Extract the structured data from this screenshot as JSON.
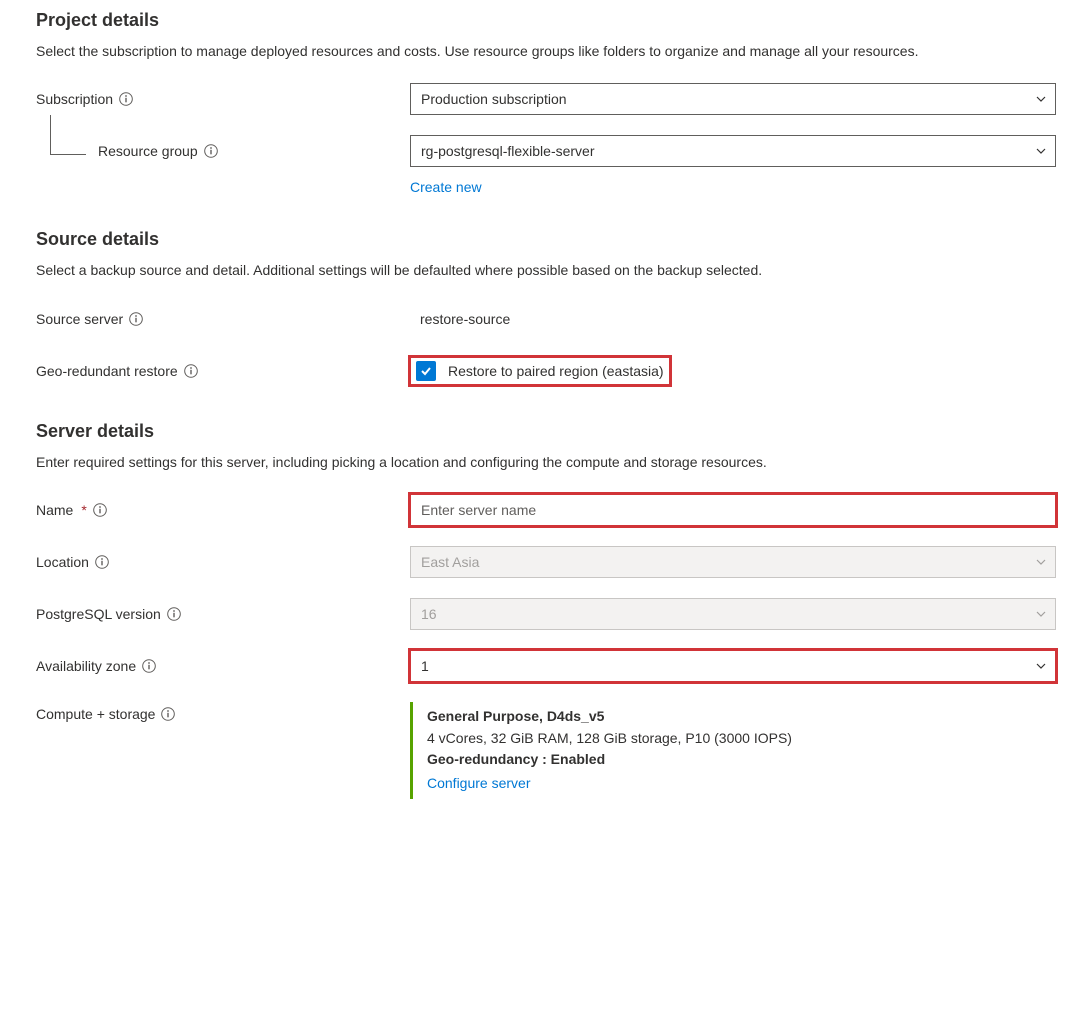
{
  "project_details": {
    "heading": "Project details",
    "description": "Select the subscription to manage deployed resources and costs. Use resource groups like folders to organize and manage all your resources.",
    "subscription": {
      "label": "Subscription",
      "value": "Production subscription"
    },
    "resource_group": {
      "label": "Resource group",
      "value": "rg-postgresql-flexible-server",
      "create_new": "Create new"
    }
  },
  "source_details": {
    "heading": "Source details",
    "description": "Select a backup source and detail. Additional settings will be defaulted where possible based on the backup selected.",
    "source_server": {
      "label": "Source server",
      "value": "restore-source"
    },
    "geo_redundant": {
      "label": "Geo-redundant restore",
      "checkbox_label": "Restore to paired region (eastasia)",
      "checked": true
    }
  },
  "server_details": {
    "heading": "Server details",
    "description": "Enter required settings for this server, including picking a location and configuring the compute and storage resources.",
    "name": {
      "label": "Name",
      "placeholder": "Enter server name",
      "value": ""
    },
    "location": {
      "label": "Location",
      "value": "East Asia"
    },
    "postgresql_version": {
      "label": "PostgreSQL version",
      "value": "16"
    },
    "availability_zone": {
      "label": "Availability zone",
      "value": "1"
    },
    "compute_storage": {
      "label": "Compute + storage",
      "title": "General Purpose, D4ds_v5",
      "specs": "4 vCores, 32 GiB RAM, 128 GiB storage, P10 (3000 IOPS)",
      "geo": "Geo-redundancy : Enabled",
      "configure": "Configure server"
    }
  }
}
